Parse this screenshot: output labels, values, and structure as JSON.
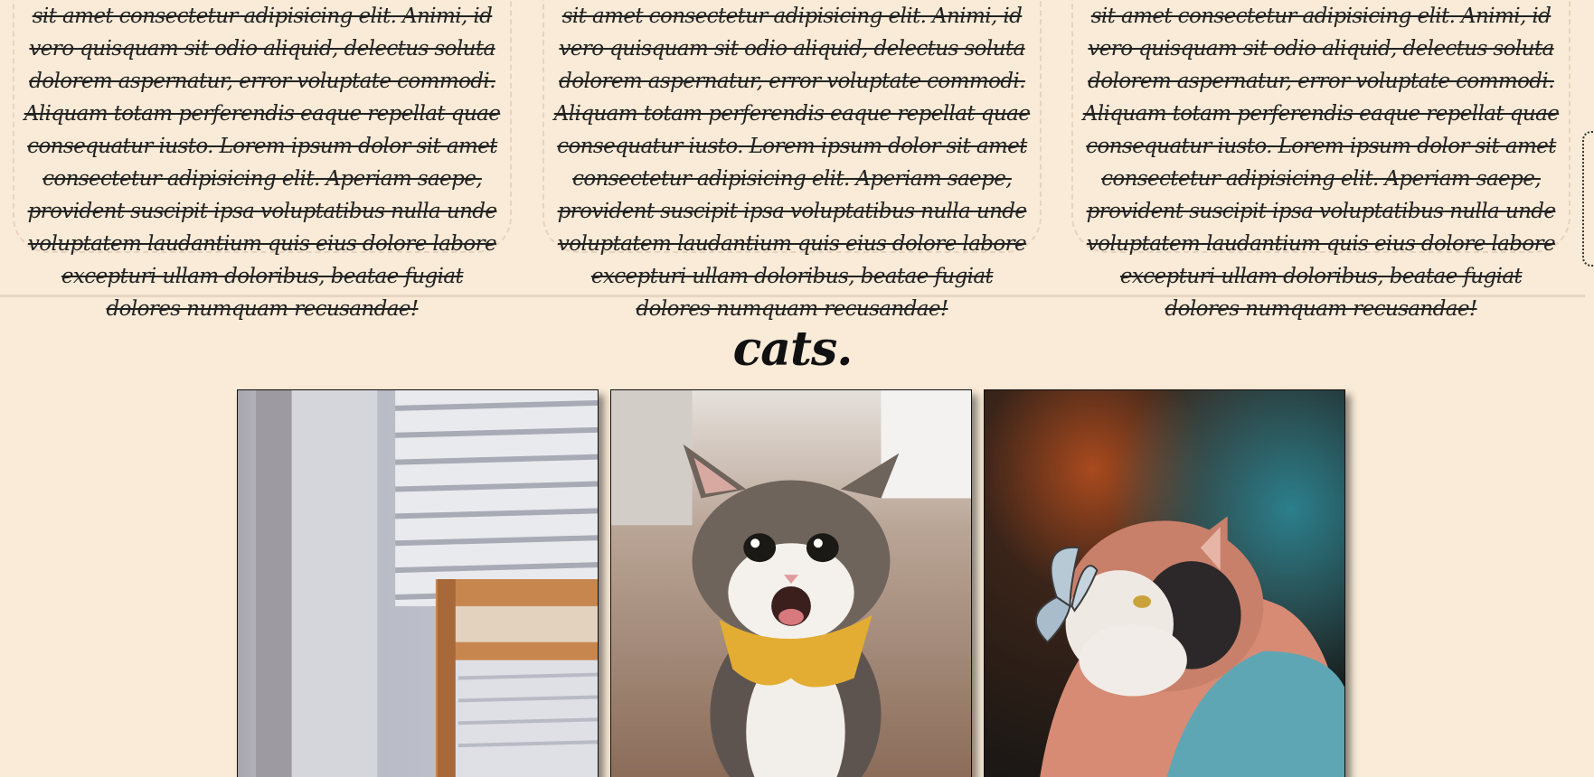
{
  "cards": [
    {
      "text": "sit amet consectetur adipisicing elit. Animi, id vero quisquam sit odio aliquid, delectus soluta dolorem aspernatur, error voluptate commodi. Aliquam totam perferendis eaque repellat quae consequatur iusto. Lorem ipsum dolor sit amet consectetur adipisicing elit. Aperiam saepe, provident suscipit ipsa voluptatibus nulla unde voluptatem laudantium quis eius dolore labore excepturi ullam doloribus, beatae fugiat dolores numquam recusandae!"
    },
    {
      "text": "sit amet consectetur adipisicing elit. Animi, id vero quisquam sit odio aliquid, delectus soluta dolorem aspernatur, error voluptate commodi. Aliquam totam perferendis eaque repellat quae consequatur iusto. Lorem ipsum dolor sit amet consectetur adipisicing elit. Aperiam saepe, provident suscipit ipsa voluptatibus nulla unde voluptatem laudantium quis eius dolore labore excepturi ullam doloribus, beatae fugiat dolores numquam recusandae!"
    },
    {
      "text": "sit amet consectetur adipisicing elit. Animi, id vero quisquam sit odio aliquid, delectus soluta dolorem aspernatur, error voluptate commodi. Aliquam totam perferendis eaque repellat quae consequatur iusto. Lorem ipsum dolor sit amet consectetur adipisicing elit. Aperiam saepe, provident suscipit ipsa voluptatibus nulla unde voluptatem laudantium quis eius dolore labore excepturi ullam doloribus, beatae fugiat dolores numquam recusandae!"
    }
  ],
  "cats_section": {
    "title": "cats."
  },
  "colors": {
    "background": "#f9ebd7",
    "card_border": "#e8d3bf",
    "divider": "#e8d6c2"
  }
}
